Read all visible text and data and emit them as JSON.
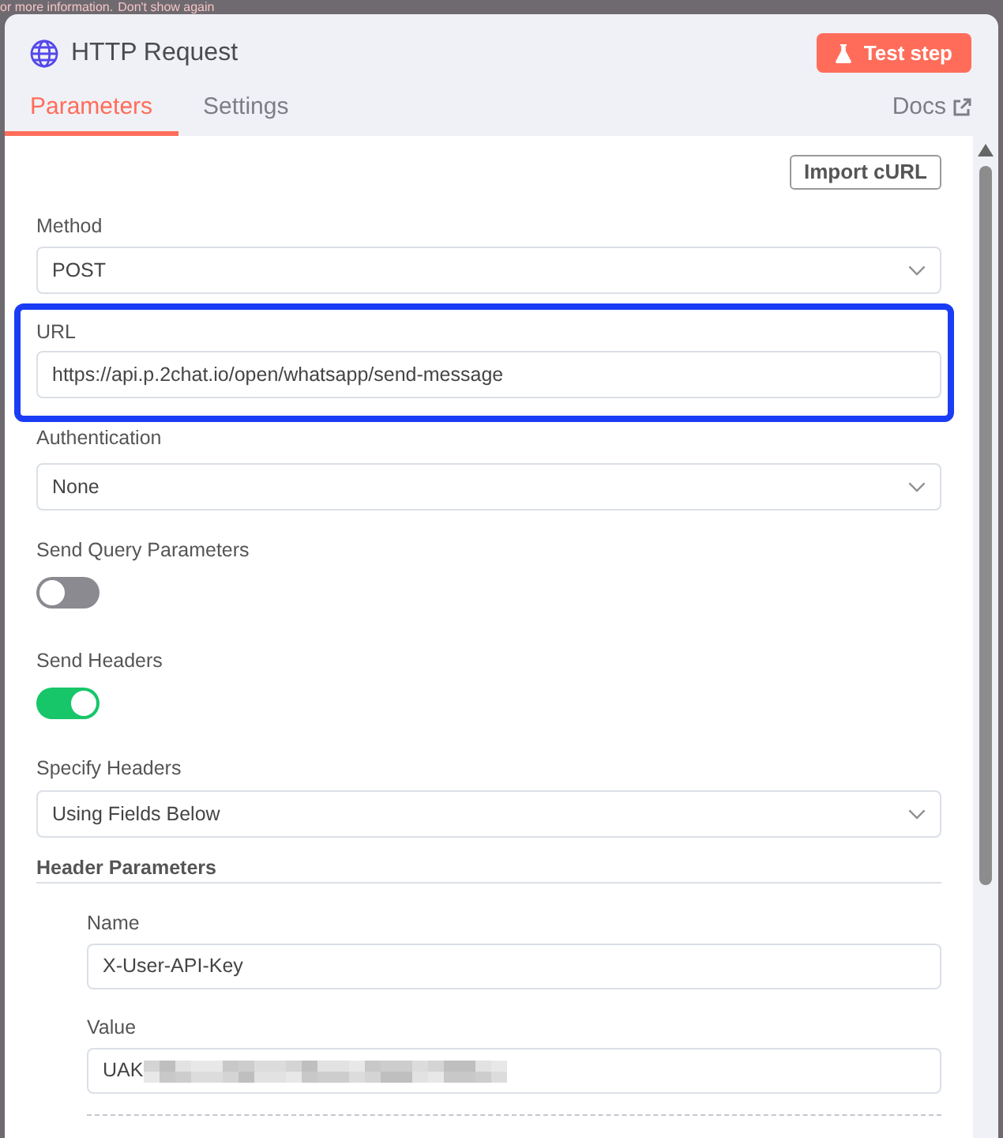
{
  "notice": {
    "text": "or more information.",
    "link": "Don't show again"
  },
  "node": {
    "title": "HTTP Request",
    "test_button": "Test step"
  },
  "tabs": [
    {
      "label": "Parameters",
      "selected": true
    },
    {
      "label": "Settings",
      "selected": false
    }
  ],
  "docs_link": "Docs",
  "import_button": "Import cURL",
  "fields": [
    {
      "kind": "select",
      "label": "Method",
      "value": "POST",
      "highlighted": false
    },
    {
      "kind": "input",
      "label": "URL",
      "value": "https://api.p.2chat.io/open/whatsapp/send-message",
      "highlighted": true
    },
    {
      "kind": "select",
      "label": "Authentication",
      "value": "None",
      "highlighted": false
    },
    {
      "kind": "toggle",
      "label": "Send Query Parameters",
      "on": false,
      "highlighted": false
    },
    {
      "kind": "toggle",
      "label": "Send Headers",
      "on": true,
      "highlighted": false
    },
    {
      "kind": "select",
      "label": "Specify Headers",
      "value": "Using Fields Below",
      "highlighted": false
    }
  ],
  "header_parameters": {
    "title": "Header Parameters",
    "items": [
      {
        "label": "Name",
        "value": "X-User-API-Key",
        "redacted": false
      },
      {
        "label": "Value",
        "value": "UAK",
        "redacted": true
      }
    ]
  }
}
